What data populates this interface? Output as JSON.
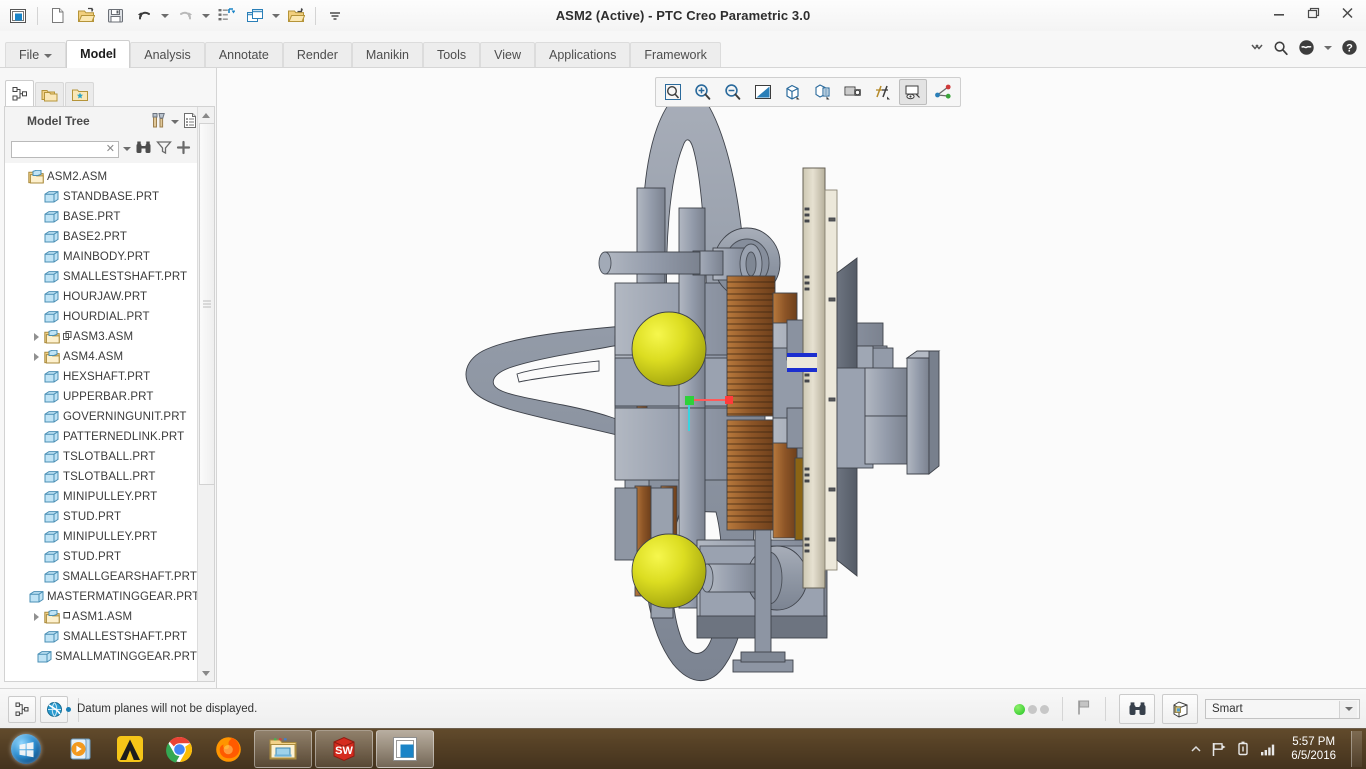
{
  "window": {
    "title": "ASM2 (Active) - PTC Creo Parametric 3.0",
    "minimize": "—",
    "maximize": "❐",
    "close": "✕"
  },
  "quick_access": {
    "items": [
      {
        "name": "app-icon",
        "label": "Creo"
      },
      {
        "name": "new-icon",
        "label": "New"
      },
      {
        "name": "open-icon",
        "label": "Open"
      },
      {
        "name": "save-icon",
        "label": "Save"
      },
      {
        "name": "undo-icon",
        "label": "Undo"
      },
      {
        "name": "redo-icon",
        "label": "Redo"
      },
      {
        "name": "regenerate-icon",
        "label": "Regenerate"
      },
      {
        "name": "window-switch-icon",
        "label": "Close Window"
      },
      {
        "name": "close-window-icon",
        "label": "Open Folder"
      },
      {
        "name": "customize-qat-icon",
        "label": "Customize Quick Access Toolbar"
      }
    ]
  },
  "ribbon": {
    "file_tab": "File",
    "tabs": [
      {
        "label": "Model",
        "active": true
      },
      {
        "label": "Analysis",
        "active": false
      },
      {
        "label": "Annotate",
        "active": false
      },
      {
        "label": "Render",
        "active": false
      },
      {
        "label": "Manikin",
        "active": false
      },
      {
        "label": "Tools",
        "active": false
      },
      {
        "label": "View",
        "active": false
      },
      {
        "label": "Applications",
        "active": false
      },
      {
        "label": "Framework",
        "active": false
      }
    ],
    "right_icons": [
      {
        "name": "minimize-ribbon-icon",
        "label": "Minimize Ribbon"
      },
      {
        "name": "search-icon",
        "label": "Search"
      },
      {
        "name": "help-center-icon",
        "label": "Help Center"
      },
      {
        "name": "help-dropdown-icon",
        "label": "More"
      },
      {
        "name": "help-icon",
        "label": "Help"
      }
    ]
  },
  "left_panel": {
    "tabs": [
      {
        "name": "model-tree-tab",
        "label": "Model Tree",
        "active": true
      },
      {
        "name": "folder-browser-tab",
        "label": "Folder Browser",
        "active": false
      },
      {
        "name": "favorites-tab",
        "label": "Favorites",
        "active": false
      }
    ],
    "header_title": "Model Tree",
    "header_icons": [
      {
        "name": "settings-tools-icon",
        "label": "Settings"
      },
      {
        "name": "settings-dropdown-icon",
        "label": "Settings menu"
      },
      {
        "name": "tree-columns-icon",
        "label": "Tree Columns"
      },
      {
        "name": "tree-columns-dropdown-icon",
        "label": "Tree Columns menu"
      }
    ],
    "search": {
      "value": "",
      "placeholder": "",
      "clear_label": "✕"
    },
    "search_icons": [
      {
        "name": "search-dropdown-icon",
        "label": "Search options"
      },
      {
        "name": "find-binoculars-icon",
        "label": "Find"
      },
      {
        "name": "filter-icon",
        "label": "Filter"
      },
      {
        "name": "add-icon",
        "label": "Add"
      }
    ],
    "tree": [
      {
        "label": "ASM2.ASM",
        "indent": 0,
        "icon": "assembly",
        "expander": false,
        "badge": ""
      },
      {
        "label": "STANDBASE.PRT",
        "indent": 1,
        "icon": "part",
        "expander": false,
        "badge": ""
      },
      {
        "label": "BASE.PRT",
        "indent": 1,
        "icon": "part",
        "expander": false,
        "badge": ""
      },
      {
        "label": "BASE2.PRT",
        "indent": 1,
        "icon": "part",
        "expander": false,
        "badge": ""
      },
      {
        "label": "MAINBODY.PRT",
        "indent": 1,
        "icon": "part",
        "expander": false,
        "badge": ""
      },
      {
        "label": "SMALLESTSHAFT.PRT",
        "indent": 1,
        "icon": "part",
        "expander": false,
        "badge": ""
      },
      {
        "label": "HOURJAW.PRT",
        "indent": 1,
        "icon": "part",
        "expander": false,
        "badge": ""
      },
      {
        "label": "HOURDIAL.PRT",
        "indent": 1,
        "icon": "part",
        "expander": false,
        "badge": ""
      },
      {
        "label": "ASM3.ASM",
        "indent": 1,
        "icon": "assembly",
        "expander": true,
        "badge": "flex"
      },
      {
        "label": "ASM4.ASM",
        "indent": 1,
        "icon": "assembly",
        "expander": true,
        "badge": ""
      },
      {
        "label": "HEXSHAFT.PRT",
        "indent": 1,
        "icon": "part",
        "expander": false,
        "badge": ""
      },
      {
        "label": "UPPERBAR.PRT",
        "indent": 1,
        "icon": "part",
        "expander": false,
        "badge": ""
      },
      {
        "label": "GOVERNINGUNIT.PRT",
        "indent": 1,
        "icon": "part",
        "expander": false,
        "badge": ""
      },
      {
        "label": "PATTERNEDLINK.PRT",
        "indent": 1,
        "icon": "part",
        "expander": false,
        "badge": ""
      },
      {
        "label": "TSLOTBALL.PRT",
        "indent": 1,
        "icon": "part",
        "expander": false,
        "badge": ""
      },
      {
        "label": "TSLOTBALL.PRT",
        "indent": 1,
        "icon": "part",
        "expander": false,
        "badge": ""
      },
      {
        "label": "MINIPULLEY.PRT",
        "indent": 1,
        "icon": "part",
        "expander": false,
        "badge": ""
      },
      {
        "label": "STUD.PRT",
        "indent": 1,
        "icon": "part",
        "expander": false,
        "badge": ""
      },
      {
        "label": "MINIPULLEY.PRT",
        "indent": 1,
        "icon": "part",
        "expander": false,
        "badge": ""
      },
      {
        "label": "STUD.PRT",
        "indent": 1,
        "icon": "part",
        "expander": false,
        "badge": ""
      },
      {
        "label": "SMALLGEARSHAFT.PRT",
        "indent": 1,
        "icon": "part",
        "expander": false,
        "badge": ""
      },
      {
        "label": "MASTERMATINGGEAR.PRT",
        "indent": 1,
        "icon": "part",
        "expander": false,
        "badge": ""
      },
      {
        "label": "ASM1.ASM",
        "indent": 1,
        "icon": "assembly",
        "expander": true,
        "badge": "sq"
      },
      {
        "label": "SMALLESTSHAFT.PRT",
        "indent": 1,
        "icon": "part",
        "expander": false,
        "badge": ""
      },
      {
        "label": "SMALLMATINGGEAR.PRT",
        "indent": 1,
        "icon": "part",
        "expander": false,
        "badge": ""
      }
    ]
  },
  "graphics_toolbar": {
    "buttons": [
      {
        "name": "refit-icon",
        "label": "Refit"
      },
      {
        "name": "zoom-in-icon",
        "label": "Zoom In"
      },
      {
        "name": "zoom-out-icon",
        "label": "Zoom Out"
      },
      {
        "name": "repaint-icon",
        "label": "Repaint"
      },
      {
        "name": "display-style-icon",
        "label": "Display Style"
      },
      {
        "name": "saved-orientation-icon",
        "label": "Saved Orientations"
      },
      {
        "name": "view-manager-icon",
        "label": "View Manager"
      },
      {
        "name": "datum-display-icon",
        "label": "Datum Display Filters"
      },
      {
        "name": "annotation-display-icon",
        "label": "Annotation Display"
      },
      {
        "name": "spin-center-icon",
        "label": "Spin Center"
      }
    ]
  },
  "viewport": {
    "model_name": "ASM2",
    "background": "#fbfbfb",
    "colors": {
      "body_gray": "#8e95a3",
      "ball_yellow": "#d8d919",
      "gear_bronze": "#8a5a2b",
      "disc_cream": "#ded8c4",
      "axis_x": "#ff4545",
      "axis_y": "#3ad3e0",
      "axis_origin": "#2ed13a"
    }
  },
  "status_bar": {
    "left_buttons": [
      {
        "name": "model-tree-toggle-icon",
        "label": "Model Tree"
      },
      {
        "name": "browser-toggle-icon",
        "label": "Web Browser"
      }
    ],
    "message": "Datum planes will not be displayed.",
    "right_buttons": [
      {
        "name": "find-icon",
        "label": "Find"
      },
      {
        "name": "selection-box-icon",
        "label": "Selection"
      }
    ],
    "selection_filter": "Smart",
    "selection_filter_arrow": "▼"
  },
  "taskbar": {
    "start_label": "Start",
    "items": [
      {
        "name": "windows-media-player-icon",
        "label": "Windows Media Player"
      },
      {
        "name": "ansys-icon",
        "label": "ANSYS"
      },
      {
        "name": "google-chrome-icon",
        "label": "Google Chrome"
      },
      {
        "name": "mozilla-firefox-icon",
        "label": "Mozilla Firefox"
      },
      {
        "name": "file-explorer-icon",
        "label": "Windows Explorer"
      },
      {
        "name": "solidworks-icon",
        "label": "SolidWorks"
      },
      {
        "name": "creo-parametric-icon",
        "label": "PTC Creo Parametric"
      }
    ],
    "tray": [
      {
        "name": "show-hidden-icons-icon",
        "label": "Show hidden icons"
      },
      {
        "name": "action-center-flag-icon",
        "label": "Action Center"
      },
      {
        "name": "power-icon",
        "label": "Power"
      },
      {
        "name": "network-icon",
        "label": "Network"
      }
    ],
    "clock_time": "5:57 PM",
    "clock_date": "6/5/2016"
  }
}
